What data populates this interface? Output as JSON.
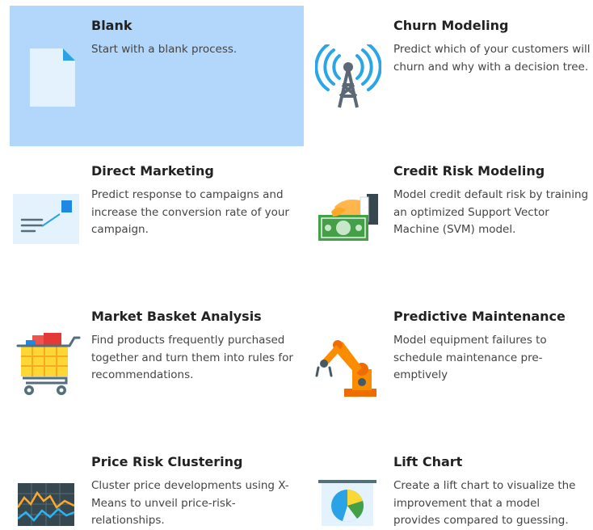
{
  "templates": [
    {
      "id": "blank",
      "title": "Blank",
      "description": "Start with a blank process.",
      "selected": true,
      "icon": "blank-document-icon"
    },
    {
      "id": "churn",
      "title": "Churn Modeling",
      "description": "Predict which of your customers will churn and why with a decision tree.",
      "selected": false,
      "icon": "radio-tower-icon"
    },
    {
      "id": "direct-marketing",
      "title": "Direct Marketing",
      "description": "Predict response to campaigns and increase the conversion rate of your campaign.",
      "selected": false,
      "icon": "envelope-icon"
    },
    {
      "id": "credit-risk",
      "title": "Credit Risk Modeling",
      "description": "Model credit default risk by training an optimized Support Vector Machine (SVM) model.",
      "selected": false,
      "icon": "hand-money-icon"
    },
    {
      "id": "market-basket",
      "title": "Market Basket Analysis",
      "description": "Find products frequently purchased together and turn them into rules for recommendations.",
      "selected": false,
      "icon": "shopping-cart-icon"
    },
    {
      "id": "predictive-maintenance",
      "title": "Predictive Maintenance",
      "description": "Model equipment failures to schedule maintenance pre-emptively",
      "selected": false,
      "icon": "robot-arm-icon"
    },
    {
      "id": "price-risk",
      "title": "Price Risk Clustering",
      "description": "Cluster price developments using X-Means to unveil price-risk-relationships.",
      "selected": false,
      "icon": "price-chart-icon"
    },
    {
      "id": "lift-chart",
      "title": "Lift Chart",
      "description": "Create a lift chart to visualize the improvement that a model provides compared to guessing.",
      "selected": false,
      "icon": "pie-chart-board-icon"
    }
  ],
  "colors": {
    "selected_background": "#b3d7fb"
  }
}
